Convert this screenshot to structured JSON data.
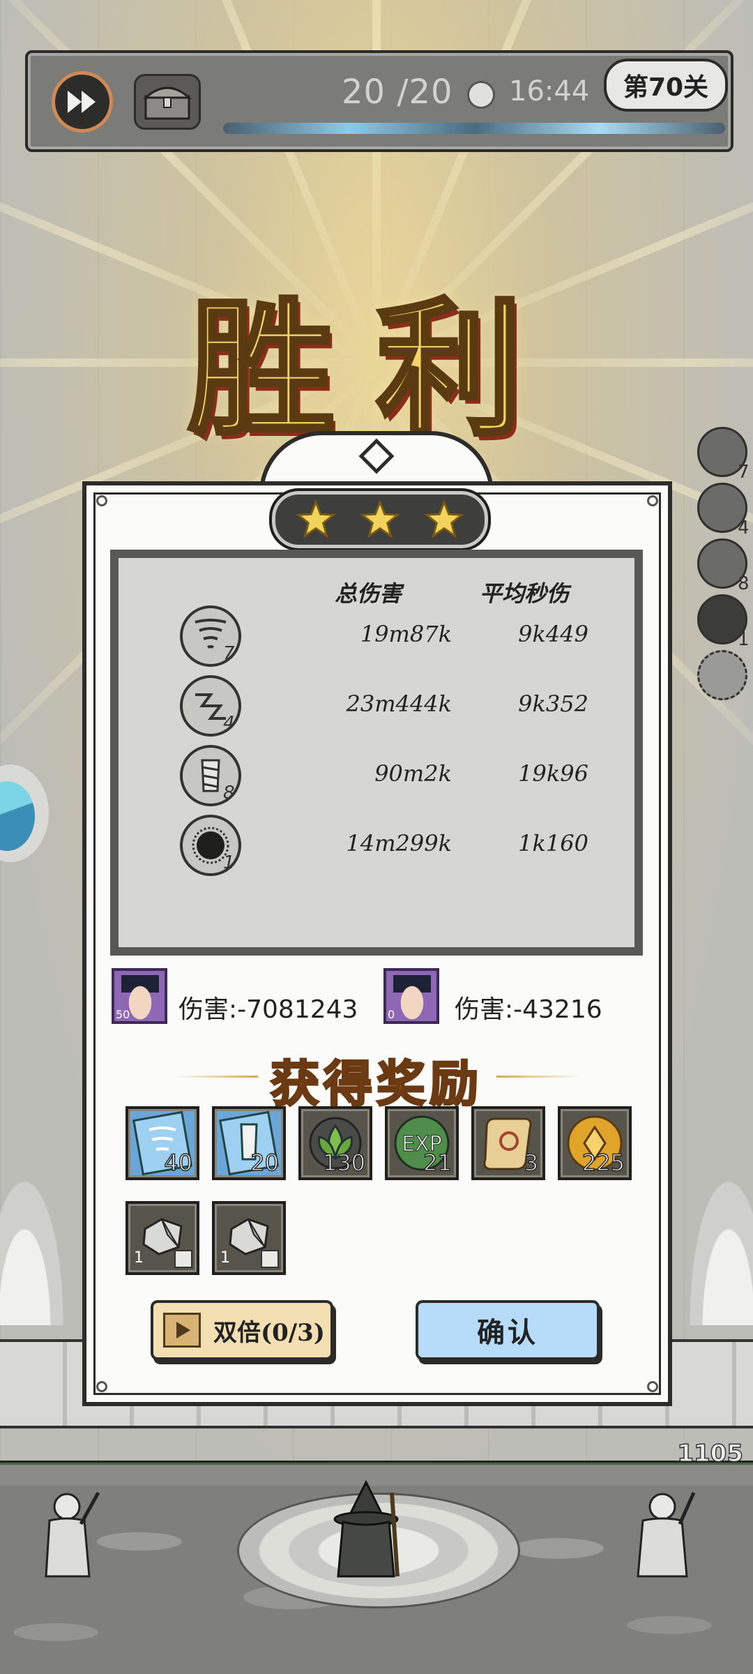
{
  "hud": {
    "wave": "20 /20",
    "timer": "16:44",
    "stage": "第70关"
  },
  "title": "胜利",
  "stars": {
    "earned": 3,
    "total": 3
  },
  "stats": {
    "header_total": "总伤害",
    "header_avg": "平均秒伤",
    "rows": [
      {
        "icon": "tornado-skill-icon",
        "level": "7",
        "total": "19m87k",
        "avg": "9k449"
      },
      {
        "icon": "lightning-skill-icon",
        "level": "4",
        "total": "23m444k",
        "avg": "9k352"
      },
      {
        "icon": "whirlwind-skill-icon",
        "level": "8",
        "total": "90m2k",
        "avg": "19k96"
      },
      {
        "icon": "black-hole-skill-icon",
        "level": "1",
        "total": "14m299k",
        "avg": "1k160"
      }
    ]
  },
  "heroes": [
    {
      "level": "50",
      "damage": "伤害:-7081243"
    },
    {
      "level": "0",
      "damage": "伤害:-43216"
    }
  ],
  "rewards_title": "获得奖励",
  "rewards": [
    {
      "icon": "tornado-scroll-icon",
      "count": "40"
    },
    {
      "icon": "whirlwind-scroll-icon",
      "count": "20"
    },
    {
      "icon": "green-leaf-icon",
      "count": "130"
    },
    {
      "icon": "exp-orb-icon",
      "label": "EXP",
      "count": "21"
    },
    {
      "icon": "scroll-icon",
      "count": "3"
    },
    {
      "icon": "gold-coin-icon",
      "count": "225"
    },
    {
      "icon": "stone-ore-icon",
      "count": "1"
    },
    {
      "icon": "stone-ore-icon",
      "count": "1"
    }
  ],
  "buttons": {
    "double": "双倍(0/3)",
    "confirm": "确认"
  },
  "side_waves": [
    "7",
    "4",
    "8",
    "1"
  ],
  "base_hp": "1105",
  "colors": {
    "star": "#f2d35b",
    "title_gold": "#f3d26a",
    "confirm_blue": "#b7dcfa",
    "double_tan": "#f4dfb3"
  }
}
